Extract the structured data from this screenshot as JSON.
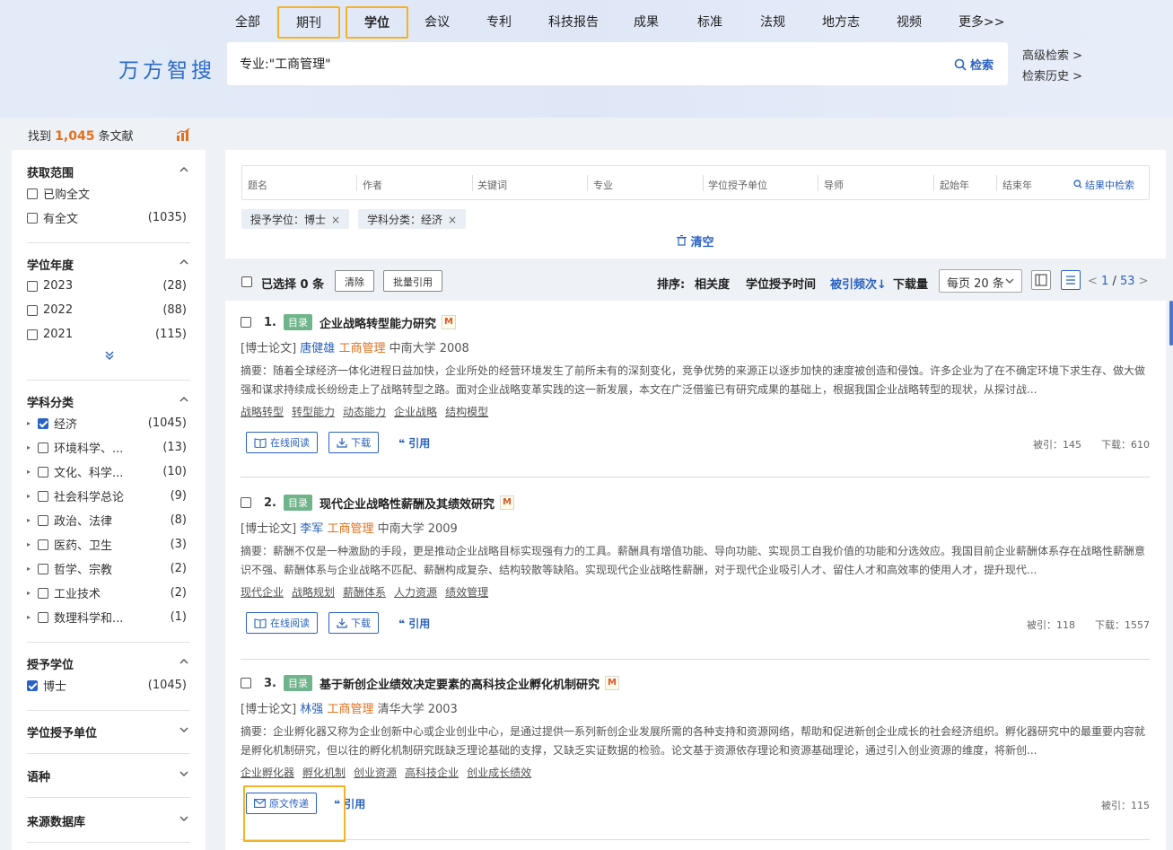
{
  "nav": {
    "items": [
      "全部",
      "期刊",
      "学位",
      "会议",
      "专利",
      "科技报告",
      "成果",
      "标准",
      "法规",
      "地方志",
      "视频",
      "更多>>"
    ],
    "active_index": 2,
    "highlighted": [
      1,
      2
    ]
  },
  "logo": "万方智搜",
  "search": {
    "value": "专业:\"工商管理\"",
    "button": "检索",
    "icon": "search-icon"
  },
  "advanced_links": [
    "高级检索 >",
    "检索历史 >"
  ],
  "summary": {
    "prefix": "找到",
    "count": "1,045",
    "suffix": "条文献"
  },
  "facets": {
    "scope": {
      "title": "获取范围",
      "items": [
        {
          "label": "已购全文",
          "count": "",
          "checked": false
        },
        {
          "label": "有全文",
          "count": "(1035)",
          "checked": false
        }
      ]
    },
    "year": {
      "title": "学位年度",
      "items": [
        {
          "label": "2023",
          "count": "(28)",
          "checked": false
        },
        {
          "label": "2022",
          "count": "(88)",
          "checked": false
        },
        {
          "label": "2021",
          "count": "(115)",
          "checked": false
        }
      ]
    },
    "subject": {
      "title": "学科分类",
      "items": [
        {
          "label": "经济",
          "count": "(1045)",
          "checked": true
        },
        {
          "label": "环境科学、...",
          "count": "(13)",
          "checked": false
        },
        {
          "label": "文化、科学...",
          "count": "(10)",
          "checked": false
        },
        {
          "label": "社会科学总论",
          "count": "(9)",
          "checked": false
        },
        {
          "label": "政治、法律",
          "count": "(8)",
          "checked": false
        },
        {
          "label": "医药、卫生",
          "count": "(3)",
          "checked": false
        },
        {
          "label": "哲学、宗教",
          "count": "(2)",
          "checked": false
        },
        {
          "label": "工业技术",
          "count": "(2)",
          "checked": false
        },
        {
          "label": "数理科学和...",
          "count": "(1)",
          "checked": false
        }
      ]
    },
    "degree": {
      "title": "授予学位",
      "items": [
        {
          "label": "博士",
          "count": "(1045)",
          "checked": true
        }
      ]
    },
    "institution": {
      "title": "学位授予单位"
    },
    "language": {
      "title": "语种"
    },
    "source": {
      "title": "来源数据库"
    }
  },
  "filter_fields": [
    "题名",
    "作者",
    "关键词",
    "专业",
    "学位授予单位",
    "导师",
    "起始年",
    "结束年"
  ],
  "in_result_search": "结果中检索",
  "active_tags": [
    "授予学位：博士",
    "学科分类：经济"
  ],
  "clear_all": "清空",
  "toolbar": {
    "selected": "已选择 0 条",
    "clear": "清除",
    "batch_cite": "批量引用",
    "sort_label": "排序:",
    "sort_options": [
      "相关度",
      "学位授予时间",
      "被引频次↓",
      "下载量"
    ],
    "active_sort": 2,
    "per_page": "每页 20 条",
    "pager_current": "1",
    "pager_total": "53"
  },
  "results": [
    {
      "num": "1.",
      "badge": "目录",
      "title": "企业战略转型能力研究",
      "type": "[博士论文]",
      "author": "唐健雄",
      "major": "工商管理",
      "school_year": "中南大学 2008",
      "abstract": "摘要：随着全球经济一体化进程日益加快，企业所处的经营环境发生了前所未有的深刻变化，竞争优势的来源正以逐步加快的速度被创造和侵蚀。许多企业为了在不确定环境下求生存、做大做强和谋求持续成长纷纷走上了战略转型之路。面对企业战略变革实践的这一新发展，本文在广泛借鉴已有研究成果的基础上，根据我国企业战略转型的现状，从探讨战...",
      "keywords": [
        "战略转型",
        "转型能力",
        "动态能力",
        "企业战略",
        "结构模型"
      ],
      "actions": [
        "在线阅读",
        "下载"
      ],
      "cite": "引用",
      "stats": "被引：145　　下载：610"
    },
    {
      "num": "2.",
      "badge": "目录",
      "title": "现代企业战略性薪酬及其绩效研究",
      "type": "[博士论文]",
      "author": "李军",
      "major": "工商管理",
      "school_year": "中南大学 2009",
      "abstract": "摘要：薪酬不仅是一种激励的手段，更是推动企业战略目标实现强有力的工具。薪酬具有增值功能、导向功能、实现员工自我价值的功能和分选效应。我国目前企业薪酬体系存在战略性薪酬意识不强、薪酬体系与企业战略不匹配、薪酬构成复杂、结构较散等缺陷。实现现代企业战略性薪酬，对于现代企业吸引人才、留住人才和高效率的使用人才，提升现代...",
      "keywords": [
        "现代企业",
        "战略规划",
        "薪酬体系",
        "人力资源",
        "绩效管理"
      ],
      "actions": [
        "在线阅读",
        "下载"
      ],
      "cite": "引用",
      "stats": "被引：118　　下载：1557"
    },
    {
      "num": "3.",
      "badge": "目录",
      "title": "基于新创企业绩效决定要素的高科技企业孵化机制研究",
      "type": "[博士论文]",
      "author": "林强",
      "major": "工商管理",
      "school_year": "清华大学 2003",
      "abstract": "摘要：企业孵化器又称为企业创新中心或企业创业中心，是通过提供一系列新创企业发展所需的各种支持和资源网络，帮助和促进新创企业成长的社会经济组织。孵化器研究中的最重要内容就是孵化机制研究，但以往的孵化机制研究既缺乏理论基础的支撑，又缺乏实证数据的检验。论文基于资源依存理论和资源基础理论，通过引入创业资源的维度，将新创...",
      "keywords": [
        "企业孵化器",
        "孵化机制",
        "创业资源",
        "高科技企业",
        "创业成长绩效"
      ],
      "actions": [
        "原文传递"
      ],
      "cite": "引用",
      "stats": "被引：115"
    }
  ],
  "colors": {
    "accent": "#2b62c0",
    "highlight": "#f5b324",
    "orange": "#e2711d",
    "badge": "#6fb48a"
  }
}
